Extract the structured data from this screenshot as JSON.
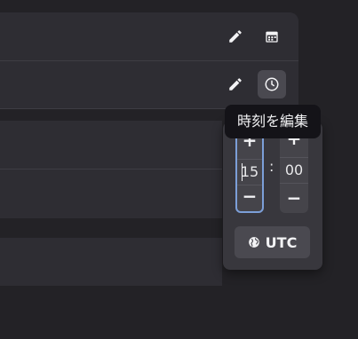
{
  "tooltip": {
    "text": "時刻を編集"
  },
  "time_picker": {
    "hours_value": "15",
    "minutes_value": "00",
    "separator": ":",
    "increment_symbol": "+",
    "decrement_symbol": "−",
    "timezone_label": "UTC"
  },
  "icons": {
    "row1": [
      "pencil-icon",
      "calendar-icon"
    ],
    "row2": [
      "pencil-icon",
      "clock-icon"
    ],
    "timezone": "globe-icon"
  },
  "colors": {
    "background": "#232226",
    "panel": "#2e2d33",
    "popover": "#38373d",
    "focus_border": "#7c9fd8",
    "tooltip": "#141318"
  }
}
